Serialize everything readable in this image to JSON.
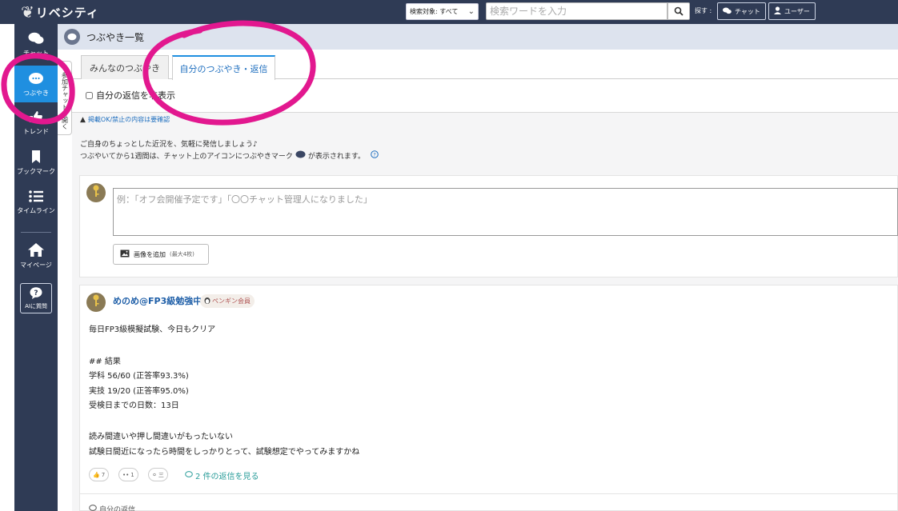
{
  "header": {
    "logo_text": "リベシティ",
    "search_scope": "検索対象: すべて",
    "search_placeholder": "検索ワードを入力",
    "explore_label": "探す :",
    "explore_chat": "チャット",
    "explore_user": "ユーザー"
  },
  "sidebar": {
    "items": [
      {
        "label": "チャット"
      },
      {
        "label": "つぶやき"
      },
      {
        "label": "トレンド"
      },
      {
        "label": "ブックマーク"
      },
      {
        "label": "タイムライン"
      },
      {
        "label": "マイページ"
      }
    ],
    "ai_label": "AIに質問"
  },
  "page": {
    "title": "つぶやき一覧",
    "side_panel_text": "参加チャットを開く",
    "tabs": [
      {
        "label": "みんなのつぶやき"
      },
      {
        "label": "自分のつぶやき・返信"
      }
    ],
    "hide_replies_label": "自分の返信を非表示",
    "notice": "掲載OK/禁止の内容は要確認",
    "intro_line1": "ご自身のちょっとした近況を、気軽に発信しましょう♪",
    "intro_line2": "つぶやいてから1週間は、チャット上のアイコンにつぶやきマーク",
    "intro_line2_tail": "が表示されます。"
  },
  "compose": {
    "placeholder": "例：「オフ会開催予定です」「〇〇チャット管理人になりました」",
    "add_image_label": "画像を追加",
    "add_image_note": "(最大4枚)"
  },
  "post": {
    "author": "めのめ@FP3級勉強中",
    "badge": "ペンギン会員",
    "lines": [
      "毎日FP3級模擬試験、今日もクリア",
      "## 結果",
      "学科 56/60 (正答率93.3%)",
      "実技 19/20 (正答率95.0%)",
      "受検日までの日数：13日",
      "読み間違いや押し間違いがもったいない",
      "試験日間近になったら時間をしっかりとって、試験想定でやってみますかね"
    ],
    "reactions": [
      {
        "icon": "👍",
        "count": "7"
      },
      {
        "icon": "••",
        "count": "1"
      },
      {
        "icon": "⚪",
        "count": "三"
      }
    ],
    "replies_link": "2 件の返信を見る",
    "my_reply_label": "自分の返信"
  },
  "colors": {
    "navy": "#2f3b55",
    "accent_blue": "#1f8fe0",
    "annotation_pink": "#e2188f"
  }
}
